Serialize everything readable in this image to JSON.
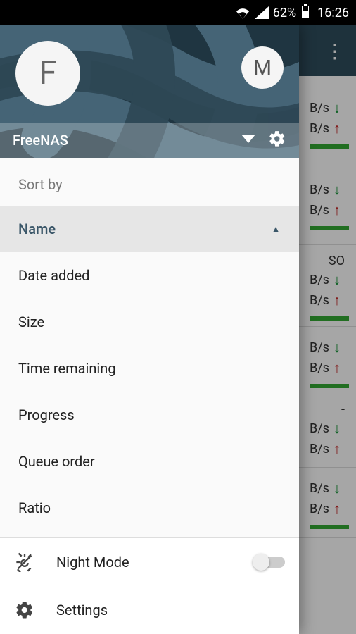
{
  "status": {
    "battery_pct": "62%",
    "time": "16:26"
  },
  "background": {
    "row_title_fragment": "SO",
    "rate_suffix": "B/s",
    "dash": "-"
  },
  "drawer": {
    "avatar_big": "F",
    "avatar_small": "M",
    "server_name": "FreeNAS",
    "sort_section_title": "Sort by",
    "sort_items": [
      {
        "label": "Name",
        "active": true
      },
      {
        "label": "Date added",
        "active": false
      },
      {
        "label": "Size",
        "active": false
      },
      {
        "label": "Time remaining",
        "active": false
      },
      {
        "label": "Progress",
        "active": false
      },
      {
        "label": "Queue order",
        "active": false
      },
      {
        "label": "Ratio",
        "active": false
      }
    ],
    "footer": {
      "night_mode_label": "Night Mode",
      "night_mode_on": false,
      "settings_label": "Settings"
    }
  }
}
